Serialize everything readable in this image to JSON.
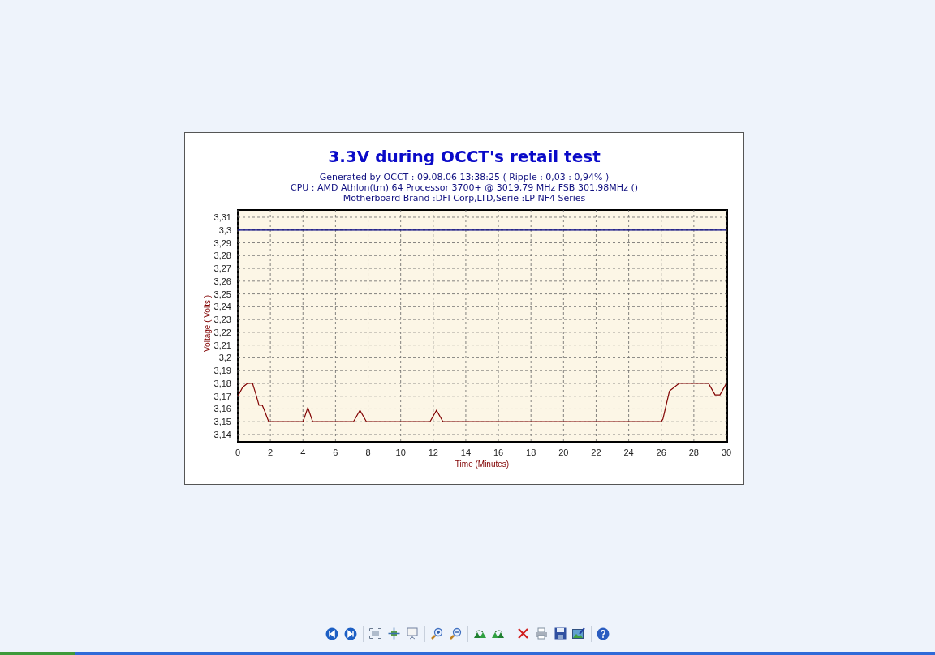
{
  "chart": {
    "title": "3.3V during OCCT's retail test",
    "subtitle_lines": [
      "Generated by OCCT : 09.08.06 13:38:25 ( Ripple : 0,03 : 0,94% )",
      "CPU : AMD Athlon(tm) 64 Processor 3700+ @ 3019,79 MHz FSB 301,98MHz ()",
      "Motherboard Brand :DFI Corp,LTD,Serie :LP NF4 Series"
    ],
    "chart_data": {
      "type": "line",
      "xlabel": "Time (Minutes)",
      "ylabel": "Voltage ( Volts )",
      "x": [
        0,
        0.3,
        0.6,
        0.9,
        1.1,
        1.3,
        1.5,
        1.6,
        1.9,
        4.0,
        4.3,
        4.6,
        7.1,
        7.5,
        7.9,
        11.8,
        12.2,
        12.6,
        26.0,
        26.1,
        26.5,
        26.7,
        27.1,
        28.0,
        28.9,
        29.3,
        29.6,
        30
      ],
      "series": [
        {
          "color": "#000080",
          "values": [
            3.3,
            3.3,
            3.3,
            3.3,
            3.3,
            3.3,
            3.3,
            3.3,
            3.3,
            3.3,
            3.3,
            3.3,
            3.3,
            3.3,
            3.3,
            3.3,
            3.3,
            3.3,
            3.3,
            3.3,
            3.3,
            3.3,
            3.3,
            3.3,
            3.3,
            3.3,
            3.3,
            3.3
          ]
        },
        {
          "color": "#800000",
          "values": [
            3.17,
            3.177,
            3.18,
            3.18,
            3.172,
            3.163,
            3.163,
            3.16,
            3.15,
            3.15,
            3.161,
            3.15,
            3.15,
            3.159,
            3.15,
            3.15,
            3.159,
            3.15,
            3.15,
            3.152,
            3.174,
            3.176,
            3.18,
            3.18,
            3.18,
            3.171,
            3.171,
            3.18
          ]
        }
      ],
      "grid": true,
      "xlim": [
        0,
        30
      ],
      "ylim": [
        3.1343,
        3.3157
      ],
      "xticks": [
        0,
        2,
        4,
        6,
        8,
        10,
        12,
        14,
        16,
        18,
        20,
        22,
        24,
        26,
        28,
        30
      ],
      "yticks": [
        {
          "value": 3.14,
          "label": "3,14"
        },
        {
          "value": 3.15,
          "label": "3,15"
        },
        {
          "value": 3.16,
          "label": "3,16"
        },
        {
          "value": 3.17,
          "label": "3,17"
        },
        {
          "value": 3.18,
          "label": "3,18"
        },
        {
          "value": 3.19,
          "label": "3,19"
        },
        {
          "value": 3.2,
          "label": "3,2"
        },
        {
          "value": 3.21,
          "label": "3,21"
        },
        {
          "value": 3.22,
          "label": "3,22"
        },
        {
          "value": 3.23,
          "label": "3,23"
        },
        {
          "value": 3.24,
          "label": "3,24"
        },
        {
          "value": 3.25,
          "label": "3,25"
        },
        {
          "value": 3.26,
          "label": "3,26"
        },
        {
          "value": 3.27,
          "label": "3,27"
        },
        {
          "value": 3.28,
          "label": "3,28"
        },
        {
          "value": 3.29,
          "label": "3,29"
        },
        {
          "value": 3.3,
          "label": "3,3"
        },
        {
          "value": 3.31,
          "label": "3,31"
        }
      ]
    }
  }
}
